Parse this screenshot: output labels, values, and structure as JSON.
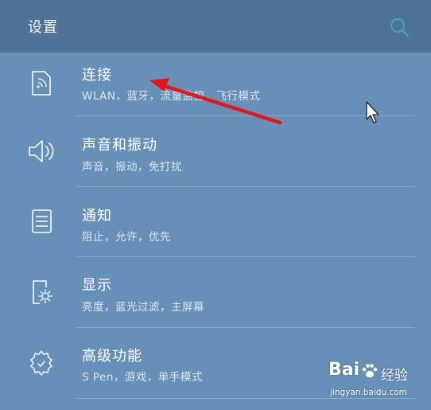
{
  "header": {
    "title": "设置",
    "search_icon": "search-icon"
  },
  "settings": [
    {
      "label": "连接",
      "sub": "WLAN，蓝牙，流量监控，飞行模式",
      "icon": "connection-icon"
    },
    {
      "label": "声音和振动",
      "sub": "声音，振动，免打扰",
      "icon": "speaker-icon"
    },
    {
      "label": "通知",
      "sub": "阻止，允许，优先",
      "icon": "notification-icon"
    },
    {
      "label": "显示",
      "sub": "亮度，蓝光过滤，主屏幕",
      "icon": "display-icon"
    },
    {
      "label": "高级功能",
      "sub": "S Pen，游戏，单手模式",
      "icon": "advanced-gear-icon"
    }
  ],
  "annotation": {
    "arrow_color": "#e3171b"
  },
  "watermark": {
    "logo": "Bai",
    "brand": "经验",
    "url": "jingyan.baidu.com"
  },
  "colors": {
    "background": "#6790b8",
    "header": "#4f7398",
    "accent": "#3fa3c4"
  }
}
